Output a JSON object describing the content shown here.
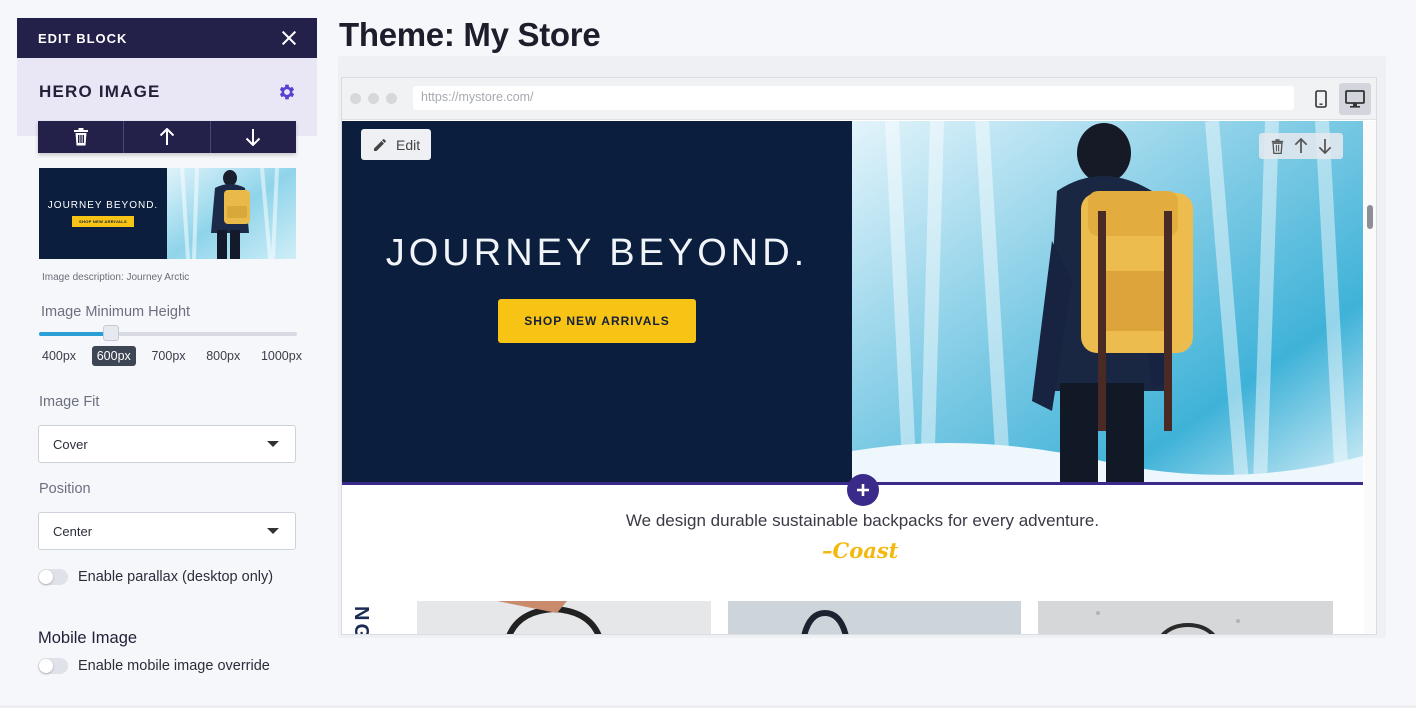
{
  "panel": {
    "header_title": "EDIT BLOCK",
    "block_name": "HERO IMAGE",
    "thumbnail": {
      "title": "JOURNEY BEYOND.",
      "button": "SHOP NEW ARRIVALS"
    },
    "image_description": "Image description: Journey Arctic",
    "min_height": {
      "label": "Image Minimum Height",
      "options": [
        "400px",
        "600px",
        "700px",
        "800px",
        "1000px"
      ],
      "selected": "600px",
      "fraction": 0.28
    },
    "image_fit": {
      "label": "Image Fit",
      "value": "Cover"
    },
    "position": {
      "label": "Position",
      "value": "Center"
    },
    "parallax": {
      "label": "Enable parallax (desktop only)",
      "on": false
    },
    "mobile_section": "Mobile Image",
    "mobile_override": {
      "label": "Enable mobile image override",
      "on": false
    }
  },
  "page": {
    "title": "Theme: My Store"
  },
  "preview": {
    "url": "https://mystore.com/",
    "edit_label": "Edit",
    "hero_title": "JOURNEY BEYOND.",
    "hero_button": "SHOP NEW ARRIVALS",
    "tagline": "We design durable sustainable backpacks for every adventure.",
    "signature": "–Coast",
    "vertical_text": "NG"
  },
  "colors": {
    "panel_dark": "#23204a",
    "panel_light": "#e9e7f6",
    "accent_purple": "#3a2a8a",
    "gear": "#5a3fd1",
    "hero_navy": "#0b1e3d",
    "cta_yellow": "#f7c315",
    "slider_blue": "#2a9fd6"
  },
  "icons": {
    "close": "close-icon",
    "gear": "gear-icon",
    "trash": "trash-icon",
    "up": "arrow-up-icon",
    "down": "arrow-down-icon",
    "pencil": "pencil-icon",
    "mobile": "mobile-device-icon",
    "desktop": "desktop-device-icon",
    "plus": "plus-icon"
  }
}
